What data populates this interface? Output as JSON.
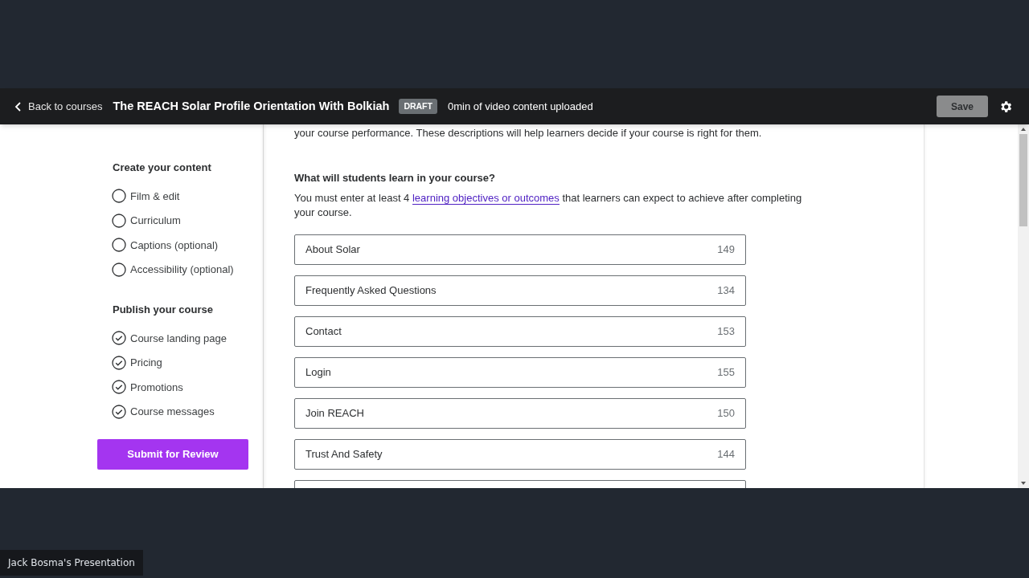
{
  "header": {
    "back_link": "Back to courses",
    "course_title": "The REACH Solar Profile Orientation With Bolkiah",
    "status_badge": "DRAFT",
    "upload_status": "0min of video content uploaded",
    "save_button": "Save"
  },
  "sidebar": {
    "sections": [
      {
        "title": "Create your content",
        "items": [
          {
            "label": "Film & edit",
            "checked": false
          },
          {
            "label": "Curriculum",
            "checked": false
          },
          {
            "label": "Captions (optional)",
            "checked": false
          },
          {
            "label": "Accessibility (optional)",
            "checked": false
          }
        ]
      },
      {
        "title": "Publish your course",
        "items": [
          {
            "label": "Course landing page",
            "checked": true
          },
          {
            "label": "Pricing",
            "checked": true
          },
          {
            "label": "Promotions",
            "checked": true
          },
          {
            "label": "Course messages",
            "checked": true
          }
        ]
      }
    ],
    "submit_button": "Submit for Review"
  },
  "main": {
    "intro_tail": "your course performance. These descriptions will help learners decide if your course is right for them.",
    "question": "What will students learn in your course?",
    "hint_before": "You must enter at least 4",
    "hint_link": "learning objectives or outcomes",
    "hint_after": "that learners can expect to achieve after completing your course.",
    "objectives": [
      {
        "value": "About Solar",
        "remaining": "149"
      },
      {
        "value": "Frequently Asked Questions",
        "remaining": "134"
      },
      {
        "value": "Contact",
        "remaining": "153"
      },
      {
        "value": "Login",
        "remaining": "155"
      },
      {
        "value": "Join REACH",
        "remaining": "150"
      },
      {
        "value": "Trust And Safety",
        "remaining": "144"
      }
    ]
  },
  "presenter_label": "Jack Bosma's Presentation"
}
